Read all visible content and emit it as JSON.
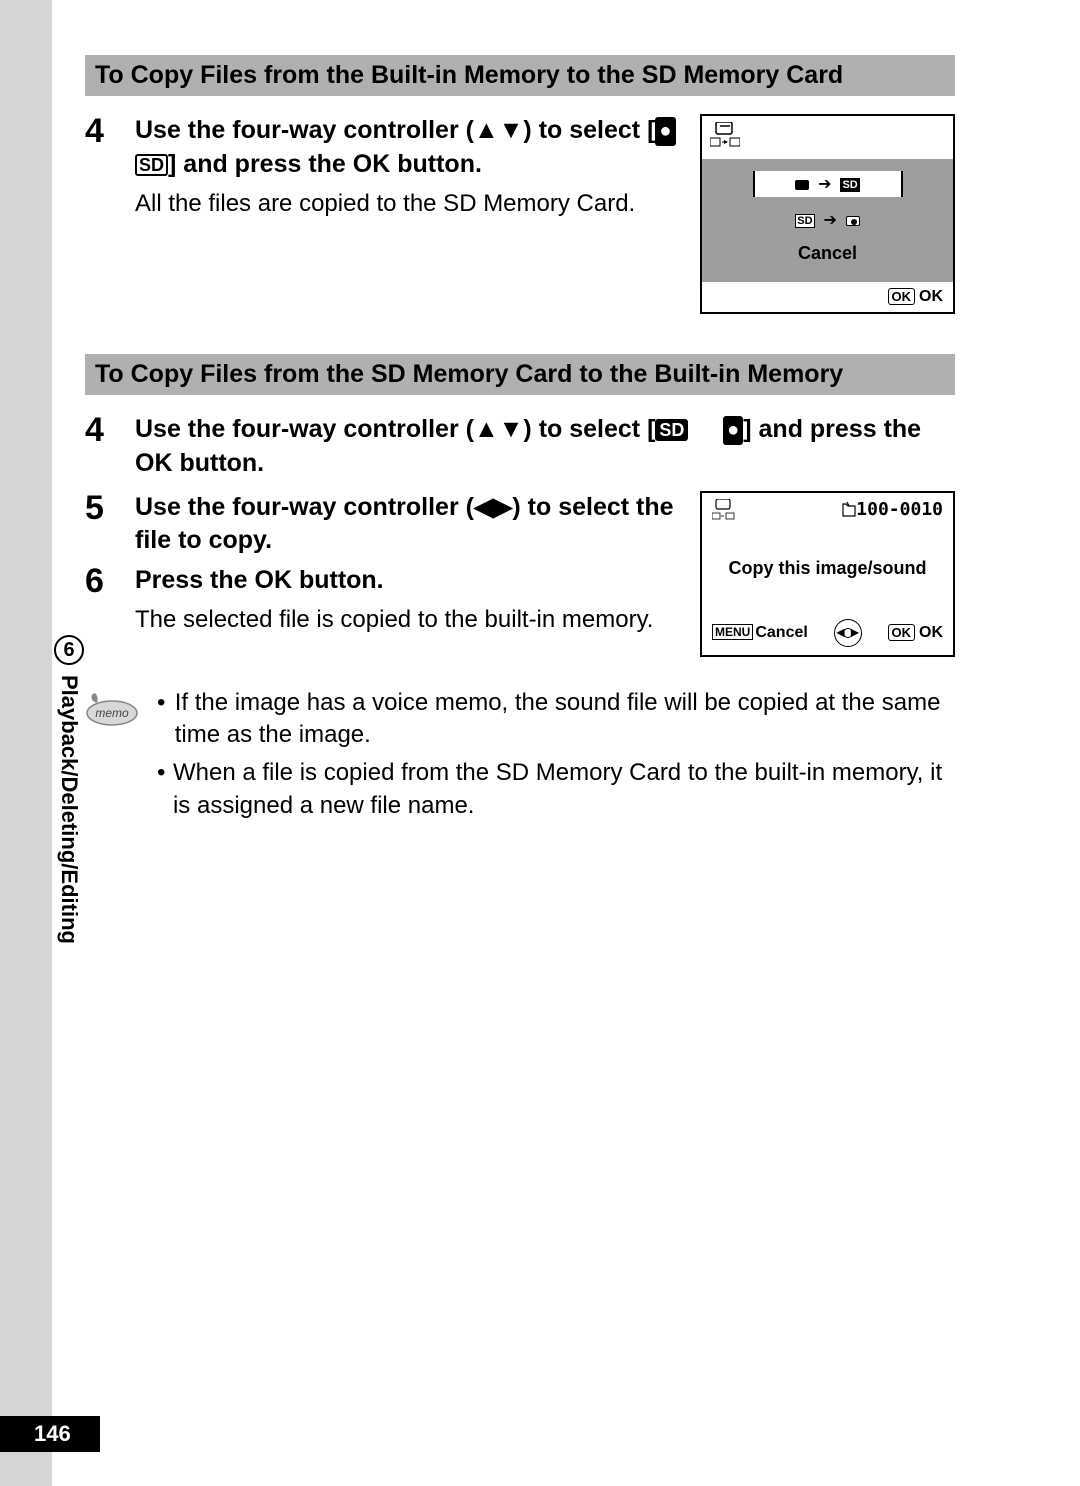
{
  "section1": {
    "heading": "To Copy Files from the Built-in Memory to the SD Memory Card",
    "step_num": "4",
    "step_text_a": "Use the four-way controller (▲▼) to select [",
    "step_text_b": "] and press the OK button.",
    "body": "All the files are copied to the SD Memory Card."
  },
  "screen1": {
    "cancel": "Cancel",
    "ok": "OK"
  },
  "section2": {
    "heading": "To Copy Files from the SD Memory Card to the Built-in Memory",
    "step4_num": "4",
    "step4_text_a": "Use the four-way controller (▲▼) to select [",
    "step4_text_b": "] and press the OK button.",
    "step5_num": "5",
    "step5_text": "Use the four-way controller (◀▶) to select the file to copy.",
    "step6_num": "6",
    "step6_text": "Press the OK button.",
    "step6_body": "The selected file is copied to the built-in memory."
  },
  "screen2": {
    "fileno": "100-0010",
    "mid": "Copy this image/sound",
    "menu": "MENU",
    "cancel": "Cancel",
    "ok": "OK"
  },
  "memo": {
    "label": "memo",
    "bullet1": "If the image has a voice memo, the sound file will be copied at the same time as the image.",
    "bullet2": "When a file is copied from the SD Memory Card to the built-in memory, it is assigned a new file name."
  },
  "side": {
    "chapter_num": "6",
    "chapter_title": "Playback/Deleting/Editing"
  },
  "page_number": "146",
  "glyphs": {
    "sd": "SD",
    "ok_badge": "OK",
    "folder": "▯"
  }
}
